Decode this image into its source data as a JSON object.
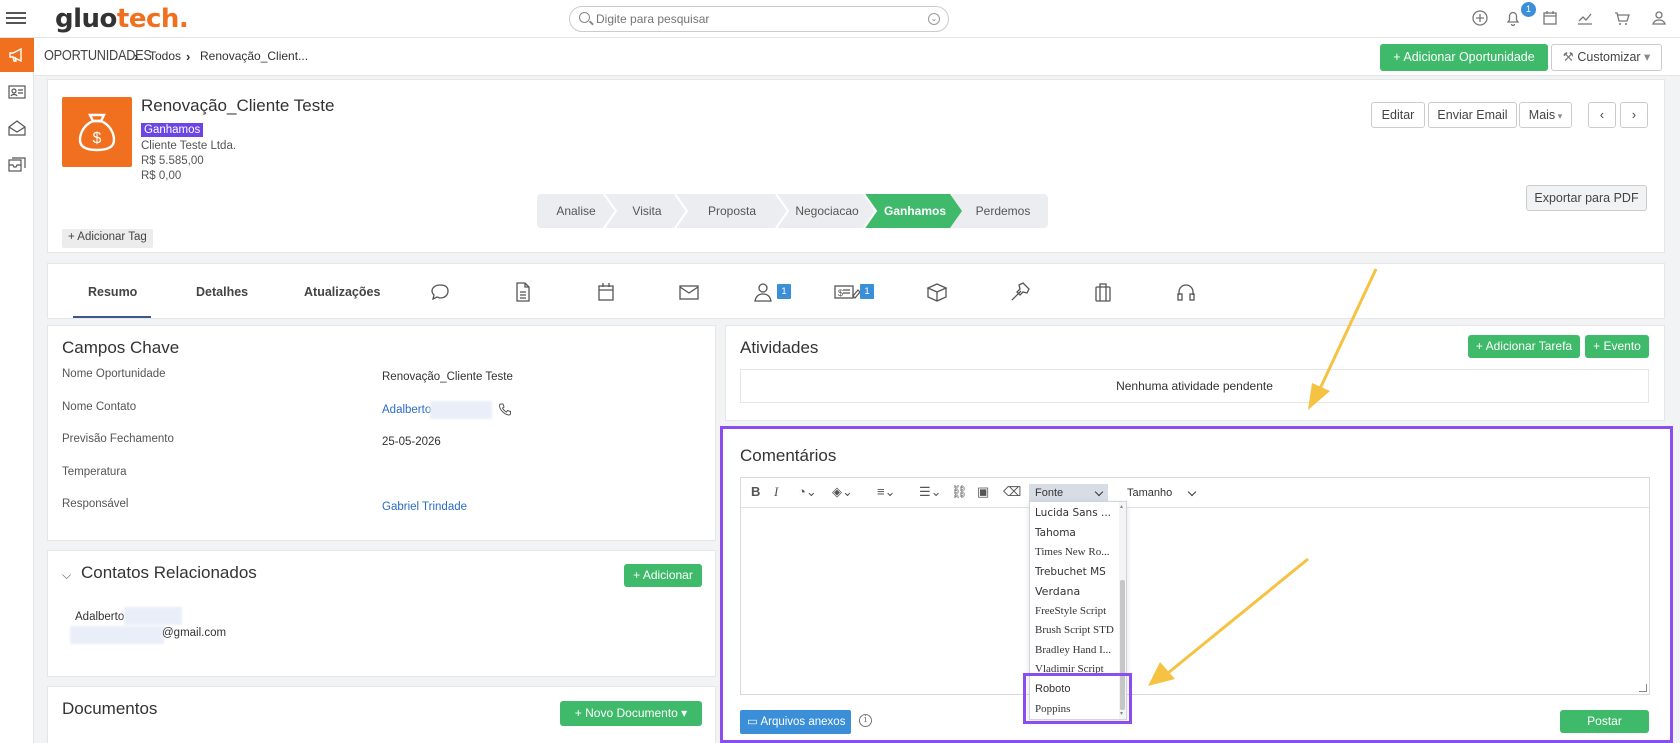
{
  "app": {
    "logo_part1": "gluo",
    "logo_part2": "tech.",
    "search_placeholder": "Digite para pesquisar",
    "notification_count": "1"
  },
  "breadcrumb": {
    "section": "OPORTUNIDADES",
    "level1": "Todos",
    "level2": "Renovação_Client..."
  },
  "header_actions": {
    "add_opportunity": "Adicionar Oportunidade",
    "customize": "Customizar",
    "edit": "Editar",
    "send_email": "Enviar Email",
    "more": "Mais",
    "export_pdf": "Exportar para PDF"
  },
  "opportunity": {
    "title": "Renovação_Cliente Teste",
    "status_badge": "Ganhamos",
    "company": "Cliente Teste Ltda.",
    "value1": "R$ 5.585,00",
    "value2": "R$ 0,00",
    "add_tag": "Adicionar Tag"
  },
  "pipeline": {
    "stages": [
      "Analise",
      "Visita",
      "Proposta",
      "Negociacao",
      "Ganhamos",
      "Perdemos"
    ],
    "active_stage": "Ganhamos"
  },
  "tabs": {
    "resumo": "Resumo",
    "detalhes": "Detalhes",
    "atualizacoes": "Atualizações",
    "contacts_badge": "1",
    "quotes_badge": "1"
  },
  "key_fields": {
    "title": "Campos Chave",
    "rows": [
      {
        "label": "Nome Oportunidade",
        "value": "Renovação_Cliente Teste"
      },
      {
        "label": "Nome Contato",
        "value": "Adalberto"
      },
      {
        "label": "Previsão Fechamento",
        "value": "25-05-2026"
      },
      {
        "label": "Temperatura",
        "value": ""
      },
      {
        "label": "Responsável",
        "value": "Gabriel Trindade"
      }
    ]
  },
  "related_contacts": {
    "title": "Contatos Relacionados",
    "add": "Adicionar",
    "contact_name": "Adalberto",
    "contact_email_suffix": "@gmail.com"
  },
  "documents": {
    "title": "Documentos",
    "new_document": "Novo Documento"
  },
  "activities": {
    "title": "Atividades",
    "add_task": "Adicionar Tarefa",
    "add_event": "Evento",
    "empty": "Nenhuma atividade pendente"
  },
  "comments": {
    "title": "Comentários",
    "font_label": "Fonte",
    "size_label": "Tamanho",
    "font_options": [
      "Lucida Sans ...",
      "Tahoma",
      "Times New Ro...",
      "Trebuchet MS",
      "Verdana",
      "FreeStyle Script",
      "Brush Script STD",
      "Bradley Hand I...",
      "Vladimir Script",
      "Roboto",
      "Poppins"
    ],
    "attachments": "Arquivos anexos",
    "post": "Postar"
  },
  "colors": {
    "brand_orange": "#f07020",
    "green": "#3fba6a",
    "highlight_purple": "#8a4df0",
    "annotation_arrow": "#f5c242",
    "link_blue": "#2a6cc7"
  }
}
